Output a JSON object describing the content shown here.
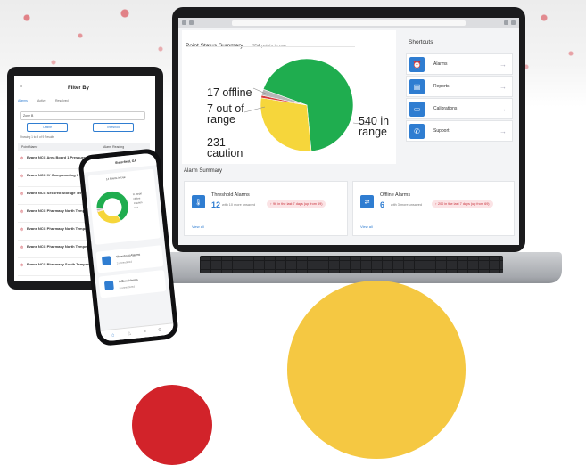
{
  "laptop": {
    "status_title": "Point Status Summary",
    "status_sub": "954 points in use",
    "shortcuts_title": "Shortcuts",
    "labels": {
      "offline": "17 offline",
      "range7_l1": "7 out of",
      "range7_l2": "range",
      "caution_l1": "231",
      "caution_l2": "caution",
      "inrange_l1": "540 in",
      "inrange_l2": "range"
    },
    "shortcuts": [
      "Alarms",
      "Reports",
      "Calibrations",
      "Support"
    ],
    "alarm_summary_title": "Alarm Summary",
    "threshold": {
      "name": "Threshold Alarms",
      "count": "12",
      "unack": "with 10 more unsaved",
      "badge": "↑ 96 in the last 7 days (up from 69)",
      "view": "View all"
    },
    "offline_alarm": {
      "name": "Offline Alarms",
      "count": "6",
      "unack": "with 3 more unsaved",
      "badge": "↑ 200 in the last 7 days (up from 69)",
      "view": "View all"
    }
  },
  "chart_data": {
    "type": "pie",
    "categories": [
      "in range",
      "caution",
      "out of range",
      "offline"
    ],
    "values": [
      540,
      231,
      7,
      17
    ],
    "colors": [
      "#1fad4f",
      "#f6d63b",
      "#d63c3c",
      "#b8b8b8"
    ]
  },
  "tablet": {
    "title": "Filter By",
    "tabs": [
      "Alarms",
      "Active",
      "Resolved"
    ],
    "search": "Zone B",
    "btn_offline": "Offline",
    "btn_threshold": "Threshold",
    "count_text": "Showing 1 to 9 of 9 Results",
    "col_name": "Point Name",
    "col_reading": "Alarm Reading",
    "rows": [
      "Evans NCC Area Board 1 Pressure",
      "Evans NCC IV Compounding 3 Pressure",
      "Evans NCC Secured Storage Temperature",
      "Evans NCC Pharmacy North Temperature",
      "Evans NCC Pharmacy North Temperature",
      "Evans NCC Pharmacy North Temperature",
      "Evans NCC Pharmacy South Temperature"
    ]
  },
  "phone": {
    "location": "Sisterfield, GA",
    "points": "14 Points in Use",
    "legend": [
      "In range",
      "Offline",
      "Caution",
      "Out"
    ],
    "card1": "Threshold Alarms",
    "card1_count": "3 unresolved",
    "card2": "Offline Alarms",
    "card2_count": "0 unresolved"
  }
}
